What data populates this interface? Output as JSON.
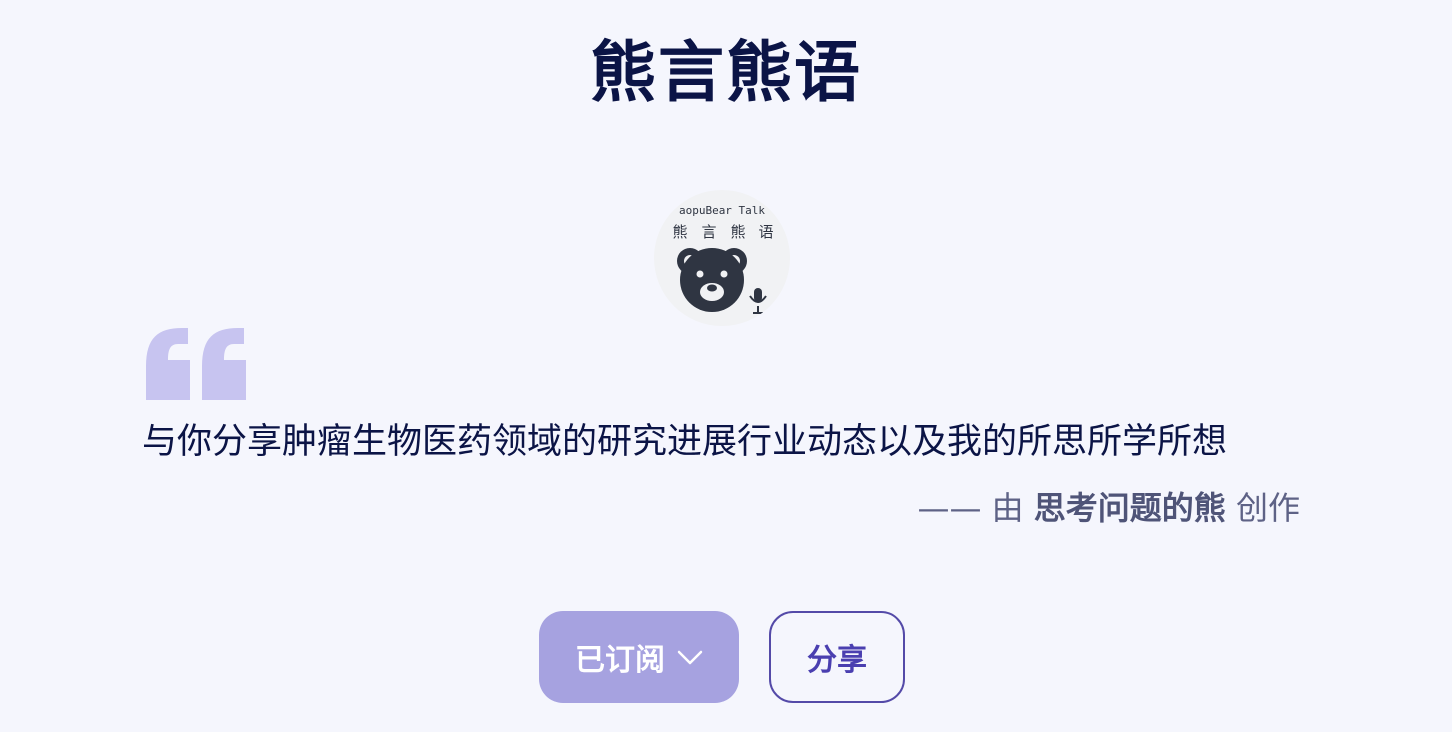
{
  "header": {
    "title": "熊言熊语"
  },
  "logo": {
    "top_text": "aopuBear Talk",
    "cn_chars": [
      "熊",
      "言",
      "熊",
      "语"
    ],
    "icons": [
      "bear-icon",
      "microphone-icon"
    ]
  },
  "quote": {
    "icon": "quote-mark-icon",
    "text": "与你分享肿瘤生物医药领域的研究进展行业动态以及我的所思所学所想"
  },
  "byline": {
    "prefix": "—— 由",
    "author": "思考问题的熊",
    "suffix": "创作"
  },
  "actions": {
    "subscribed_label": "已订阅",
    "subscribed_icon": "chevron-down-icon",
    "share_label": "分享"
  },
  "colors": {
    "background": "#f5f6fd",
    "title": "#0b1446",
    "quote_mark": "#c7c4f0",
    "subscribed_bg": "#a6a2e0",
    "share_border": "#544aa8"
  }
}
